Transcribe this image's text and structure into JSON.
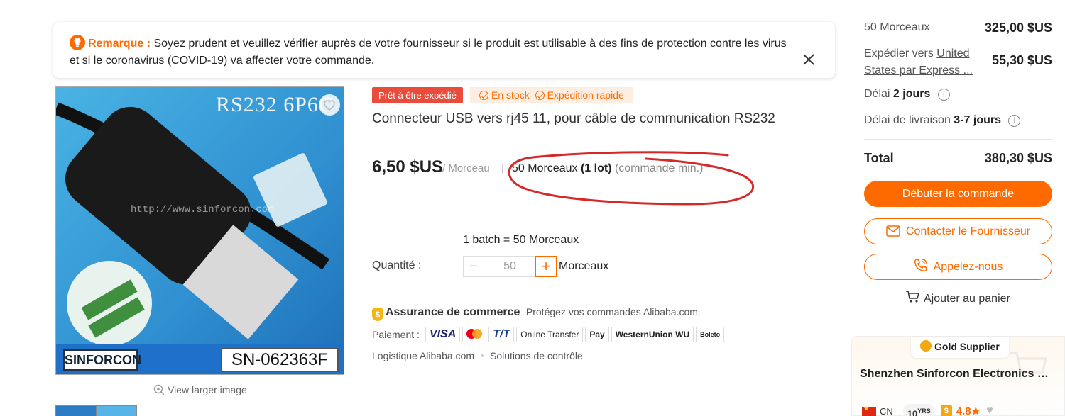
{
  "notice": {
    "label": "Remarque :",
    "text": "Soyez prudent et veuillez vérifier auprès de votre fournisseur si le produit est utilisable à des fins de protection contre les virus et si le coronavirus (COVID-19) va affecter votre commande."
  },
  "image": {
    "overlay_title": "RS232 6P6C",
    "overlay_url": "http://www.sinforcon.com",
    "brand": "SINFORCON",
    "serial": "SN-062363F",
    "view_larger": "View larger image"
  },
  "product": {
    "badge_ready": "Prêt à être expédié",
    "in_stock": "En stock",
    "fast_ship": "Expédition rapide",
    "title": "Connecteur USB vers rj45 11, pour câble de communication RS232",
    "price": "6,50 $US",
    "unit": "/ Morceau",
    "moq_qty": "50 Morceaux",
    "moq_lot": "(1 lot)",
    "moq_min": "(commande min.)",
    "batch": "1 batch = 50 Morceaux",
    "qty_label": "Quantité :",
    "qty_value": "50",
    "qty_unit": "Morceaux"
  },
  "assurance": {
    "title": "Assurance de commerce",
    "desc": "Protégez vos commandes Alibaba.com.",
    "payment_label": "Paiement :",
    "payments": [
      "VISA",
      "T/T",
      "Online Transfer",
      "Pay",
      "WesternUnion",
      "WU",
      "Boleto"
    ],
    "logistics": "Logistique Alibaba.com",
    "inspection": "Solutions de contrôle"
  },
  "summary": {
    "qty_label": "50 Morceaux",
    "qty_price": "325,00 $US",
    "ship_prefix": "Expédier vers",
    "ship_link_1": "United",
    "ship_link_2": "States par Express ...",
    "ship_price": "55,30 $US",
    "lead_label": "Délai",
    "lead_value": "2 jours",
    "delivery_label": "Délai de livraison",
    "delivery_value": "3-7 jours",
    "total_label": "Total",
    "total_value": "380,30 $US",
    "btn_order": "Débuter la commande",
    "btn_contact": "Contacter le Fournisseur",
    "btn_call": "Appelez-nous",
    "add_cart": "Ajouter au panier"
  },
  "supplier": {
    "tier": "Gold Supplier",
    "name": "Shenzhen Sinforcon Electronics L...",
    "country": "CN",
    "years": "10",
    "years_unit": "YRS",
    "rating": "4.8"
  },
  "colors": {
    "accent": "#ff6a00",
    "badge_red": "#ea4c3c",
    "annotation": "#d62828"
  }
}
